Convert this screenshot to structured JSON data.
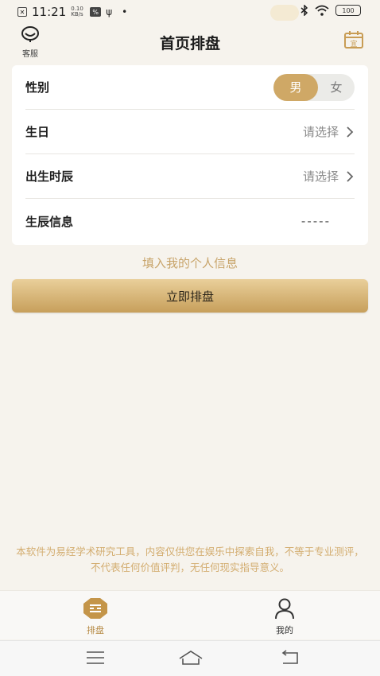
{
  "status_bar": {
    "time": "11:21",
    "net_speed_top": "0.10",
    "net_speed_bottom": "KB/s",
    "icon_badge": "%",
    "battery": "100"
  },
  "header": {
    "customer_service_label": "客服",
    "title": "首页排盘",
    "calendar_glyph": "宜"
  },
  "form": {
    "gender": {
      "label": "性别",
      "options": [
        "男",
        "女"
      ],
      "selected": "男"
    },
    "birthday": {
      "label": "生日",
      "value": "请选择"
    },
    "birth_hour": {
      "label": "出生时辰",
      "value": "请选择"
    },
    "birth_info": {
      "label": "生辰信息",
      "value": "-----"
    }
  },
  "hint_link": "填入我的个人信息",
  "primary_button": "立即排盘",
  "disclaimer": "本软件为易经学术研究工具，内容仅供您在娱乐中探索自我，不等于专业测评，不代表任何价值评判，无任何现实指导意义。",
  "bottom_nav": {
    "items": [
      {
        "label": "排盘",
        "active": true
      },
      {
        "label": "我的",
        "active": false
      }
    ]
  },
  "colors": {
    "accent": "#cfa866",
    "accent_text": "#c8a46a",
    "background": "#f6f3ed"
  }
}
